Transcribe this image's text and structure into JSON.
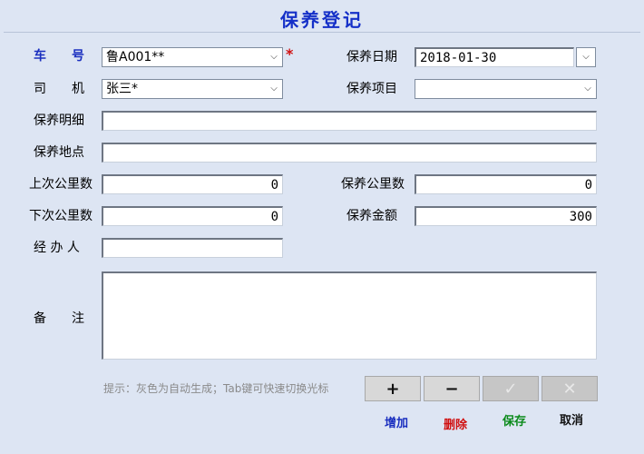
{
  "title": "保养登记",
  "form": {
    "plate": {
      "label": "车　　号",
      "value": "鲁A001**",
      "required_mark": "*"
    },
    "driver": {
      "label": "司　　机",
      "value": "张三*"
    },
    "detail": {
      "label": "保养明细",
      "value": ""
    },
    "location": {
      "label": "保养地点",
      "value": ""
    },
    "last_mileage": {
      "label": "上次公里数",
      "value": "0"
    },
    "next_mileage": {
      "label": "下次公里数",
      "value": "0"
    },
    "handler": {
      "label": "经 办 人",
      "value": ""
    },
    "remarks": {
      "label": "备　　注",
      "value": ""
    },
    "date": {
      "label": "保养日期",
      "value": "2018-01-30"
    },
    "item": {
      "label": "保养项目",
      "value": ""
    },
    "maint_mileage": {
      "label": "保养公里数",
      "value": "0"
    },
    "amount": {
      "label": "保养金额",
      "value": "300"
    }
  },
  "hint": "提示：灰色为自动生成；Tab键可快速切换光标",
  "buttons": {
    "add": {
      "symbol": "+",
      "label": "增加",
      "color": "#1a2fbf"
    },
    "delete": {
      "symbol": "−",
      "label": "删除",
      "color": "#d01010"
    },
    "save": {
      "symbol": "✓",
      "label": "保存",
      "color": "#0a8a1a"
    },
    "cancel": {
      "symbol": "✕",
      "label": "取消",
      "color": "#111111"
    }
  },
  "icons": {
    "dropdown": "chevron-down-icon",
    "date_picker": "calendar-dropdown-icon"
  }
}
